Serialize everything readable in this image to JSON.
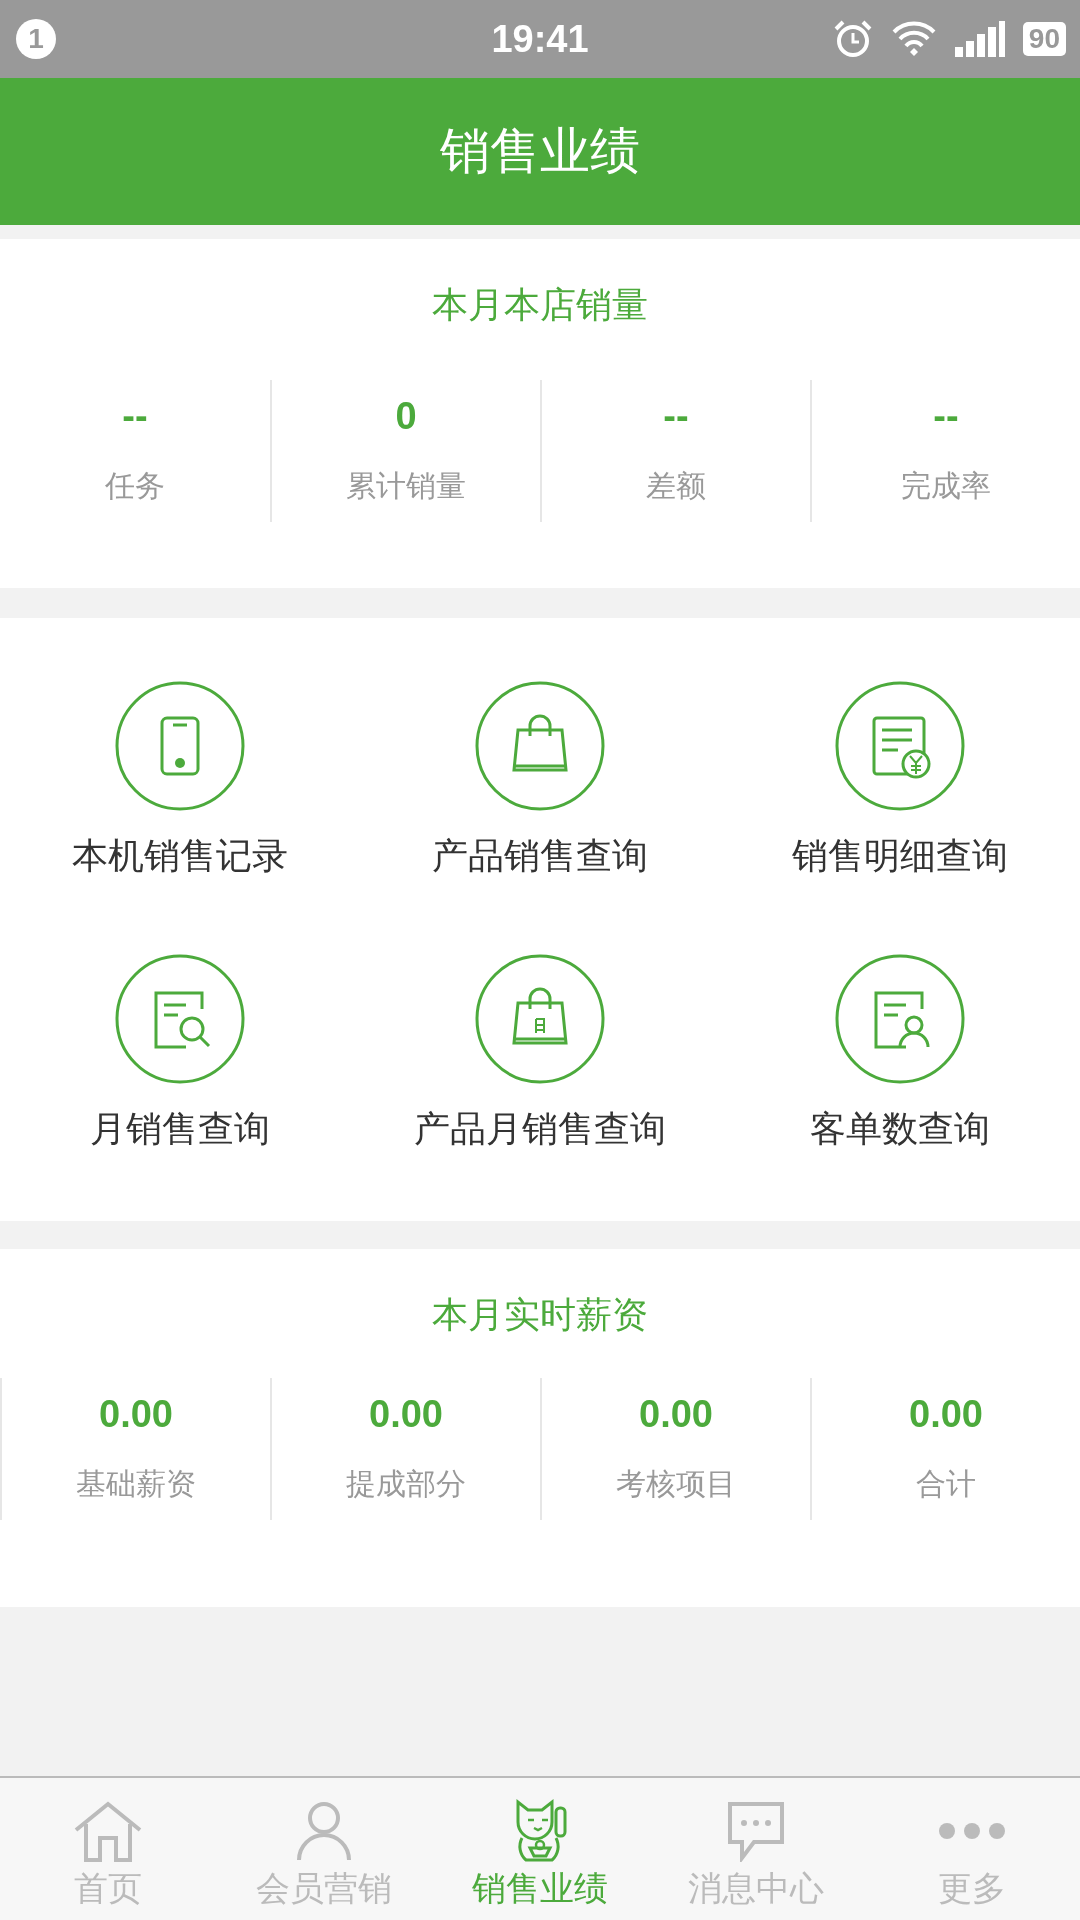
{
  "status_bar": {
    "notification_count": "1",
    "time": "19:41",
    "battery": "90"
  },
  "header": {
    "title": "销售业绩"
  },
  "store_sales": {
    "title": "本月本店销量",
    "stats": [
      {
        "value": "--",
        "label": "任务"
      },
      {
        "value": "0",
        "label": "累计销量"
      },
      {
        "value": "--",
        "label": "差额"
      },
      {
        "value": "--",
        "label": "完成率"
      }
    ]
  },
  "shortcuts": [
    {
      "label": "本机销售记录"
    },
    {
      "label": "产品销售查询"
    },
    {
      "label": "销售明细查询"
    },
    {
      "label": "月销售查询"
    },
    {
      "label": "产品月销售查询"
    },
    {
      "label": "客单数查询"
    }
  ],
  "salary": {
    "title": "本月实时薪资",
    "stats": [
      {
        "value": "0.00",
        "label": "基础薪资"
      },
      {
        "value": "0.00",
        "label": "提成部分"
      },
      {
        "value": "0.00",
        "label": "考核项目"
      },
      {
        "value": "0.00",
        "label": "合计"
      }
    ]
  },
  "tab_bar": [
    {
      "label": "首页",
      "selected": false
    },
    {
      "label": "会员营销",
      "selected": false
    },
    {
      "label": "销售业绩",
      "selected": true
    },
    {
      "label": "消息中心",
      "selected": false
    },
    {
      "label": "更多",
      "selected": false
    }
  ]
}
